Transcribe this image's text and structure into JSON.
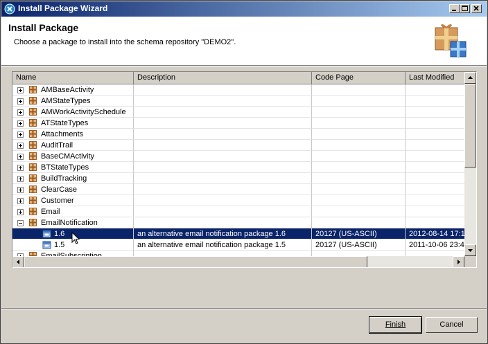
{
  "window": {
    "title": "Install Package Wizard",
    "controls": {
      "minimize_icon": "minimize-icon",
      "maximize_icon": "maximize-icon",
      "close_icon": "close-icon"
    }
  },
  "header": {
    "heading": "Install Package",
    "description": "Choose a package to install into the schema repository \"DEMO2\".",
    "icon": "package-gifts-icon"
  },
  "table": {
    "columns": [
      "Name",
      "Description",
      "Code Page",
      "Last Modified"
    ],
    "rows": [
      {
        "name": "AMBaseActivity",
        "expander": "+",
        "icon": "package-icon"
      },
      {
        "name": "AMStateTypes",
        "expander": "+",
        "icon": "package-icon"
      },
      {
        "name": "AMWorkActivitySchedule",
        "expander": "+",
        "icon": "package-icon"
      },
      {
        "name": "ATStateTypes",
        "expander": "+",
        "icon": "package-icon"
      },
      {
        "name": "Attachments",
        "expander": "+",
        "icon": "package-icon"
      },
      {
        "name": "AuditTrail",
        "expander": "+",
        "icon": "package-icon"
      },
      {
        "name": "BaseCMActivity",
        "expander": "+",
        "icon": "package-icon"
      },
      {
        "name": "BTStateTypes",
        "expander": "+",
        "icon": "package-icon"
      },
      {
        "name": "BuildTracking",
        "expander": "+",
        "icon": "package-icon"
      },
      {
        "name": "ClearCase",
        "expander": "+",
        "icon": "package-icon"
      },
      {
        "name": "Customer",
        "expander": "+",
        "icon": "package-icon"
      },
      {
        "name": "Email",
        "expander": "+",
        "icon": "package-icon"
      },
      {
        "name": "EmailNotification",
        "expander": "-",
        "icon": "package-icon"
      },
      {
        "name": "1.6",
        "version": true,
        "selected": true,
        "icon": "version-icon",
        "description": "an alternative email notification package 1.6",
        "code_page": "20127 (US-ASCII)",
        "last_modified": "2012-08-14 17:1"
      },
      {
        "name": "1.5",
        "version": true,
        "icon": "version-icon",
        "description": "an alternative email notification package 1.5",
        "code_page": "20127 (US-ASCII)",
        "last_modified": "2011-10-06 23:4"
      },
      {
        "name": "EmailSubscription",
        "expander": "+",
        "icon": "package-icon"
      }
    ]
  },
  "buttons": {
    "finish": "Finish",
    "cancel": "Cancel"
  },
  "colors": {
    "title_start": "#0a246a",
    "title_end": "#a6caf0",
    "selection": "#0a246a",
    "package_brown": "#9a5a28"
  }
}
